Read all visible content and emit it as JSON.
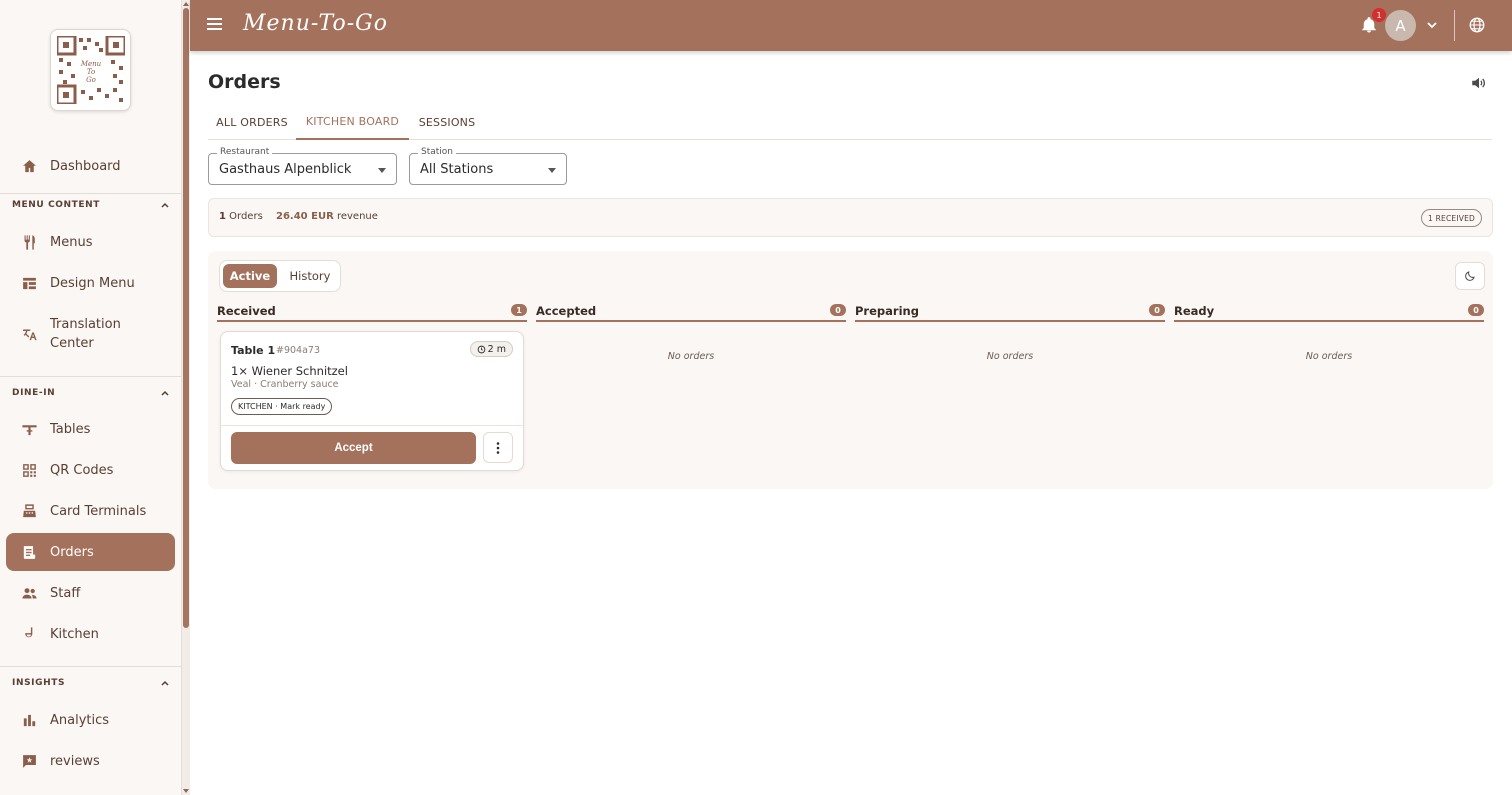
{
  "app": {
    "brand": "Menu-To-Go",
    "notification_count": "1",
    "avatar_initial": "A"
  },
  "colors": {
    "primary": "#a4725c",
    "sidebar_bg": "#faf7f4",
    "badge_red": "#d32f2f"
  },
  "sidebar": {
    "dashboard": "Dashboard",
    "sections": {
      "menu_content": "MENU CONTENT",
      "dine_in": "DINE-IN",
      "insights": "INSIGHTS"
    },
    "items": {
      "menus": "Menus",
      "design_menu": "Design Menu",
      "translation_center": "Translation Center",
      "tables": "Tables",
      "qr_codes": "QR Codes",
      "card_terminals": "Card Terminals",
      "orders": "Orders",
      "staff": "Staff",
      "kitchen": "Kitchen",
      "analytics": "Analytics",
      "reviews": "reviews"
    }
  },
  "page": {
    "title": "Orders",
    "tabs": [
      "ALL ORDERS",
      "KITCHEN BOARD",
      "SESSIONS"
    ],
    "active_tab": "KITCHEN BOARD"
  },
  "filters": {
    "restaurant": {
      "label": "Restaurant",
      "value": "Gasthaus Alpenblick"
    },
    "station": {
      "label": "Station",
      "value": "All Stations"
    }
  },
  "summary": {
    "orders_count": "1",
    "orders_label": "Orders",
    "revenue": "26.40 EUR",
    "revenue_label": "revenue",
    "received_pill": "1 RECEIVED"
  },
  "board": {
    "toggle": {
      "active": "Active",
      "history": "History"
    },
    "columns": [
      {
        "title": "Received",
        "count": "1"
      },
      {
        "title": "Accepted",
        "count": "0"
      },
      {
        "title": "Preparing",
        "count": "0"
      },
      {
        "title": "Ready",
        "count": "0"
      }
    ],
    "empty_text": "No orders",
    "order_card": {
      "table": "Table 1",
      "order_id": "#904a73",
      "elapsed": "2 m",
      "item": "1× Wiener Schnitzel",
      "description": "Veal · Cranberry sauce",
      "station_action": "KITCHEN · Mark ready",
      "accept_label": "Accept"
    }
  }
}
